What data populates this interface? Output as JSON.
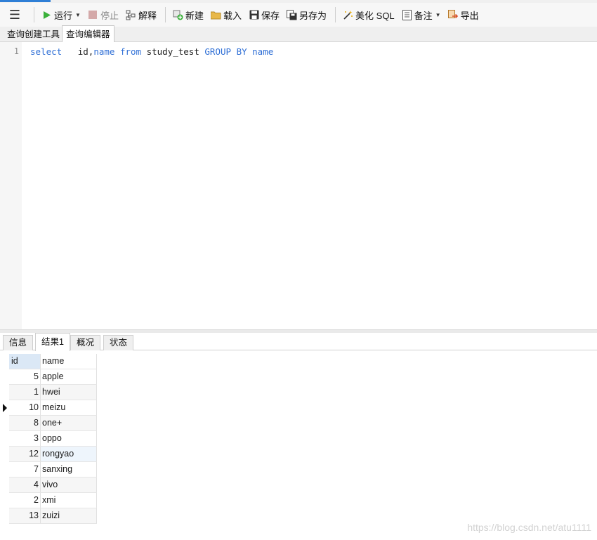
{
  "toolbar": {
    "run": "运行",
    "stop": "停止",
    "explain": "解释",
    "new": "新建",
    "load": "载入",
    "save": "保存",
    "save_as": "另存为",
    "beautify": "美化 SQL",
    "note": "备注",
    "export": "导出"
  },
  "tabs": [
    "查询创建工具",
    "查询编辑器"
  ],
  "editor": {
    "line_number": "1",
    "tokens": {
      "select": "select",
      "fields": "id,",
      "name1": "name",
      "from": "from",
      "table": "study_test",
      "group": "GROUP",
      "by": "BY",
      "name2": "name"
    }
  },
  "result_tabs": [
    "信息",
    "结果1",
    "概况",
    "状态"
  ],
  "grid": {
    "columns": [
      "id",
      "name"
    ],
    "rows": [
      {
        "id": "5",
        "name": "apple"
      },
      {
        "id": "1",
        "name": "hwei"
      },
      {
        "id": "10",
        "name": "meizu"
      },
      {
        "id": "8",
        "name": "one+"
      },
      {
        "id": "3",
        "name": "oppo"
      },
      {
        "id": "12",
        "name": "rongyao"
      },
      {
        "id": "7",
        "name": "sanxing"
      },
      {
        "id": "4",
        "name": "vivo"
      },
      {
        "id": "2",
        "name": "xmi"
      },
      {
        "id": "13",
        "name": "zuizi"
      }
    ]
  },
  "watermark": "https://blog.csdn.net/atu1111",
  "colors": {
    "keyword": "#2f6fd6",
    "accent": "#2f7fd6",
    "run_icon": "#3ab03a"
  }
}
